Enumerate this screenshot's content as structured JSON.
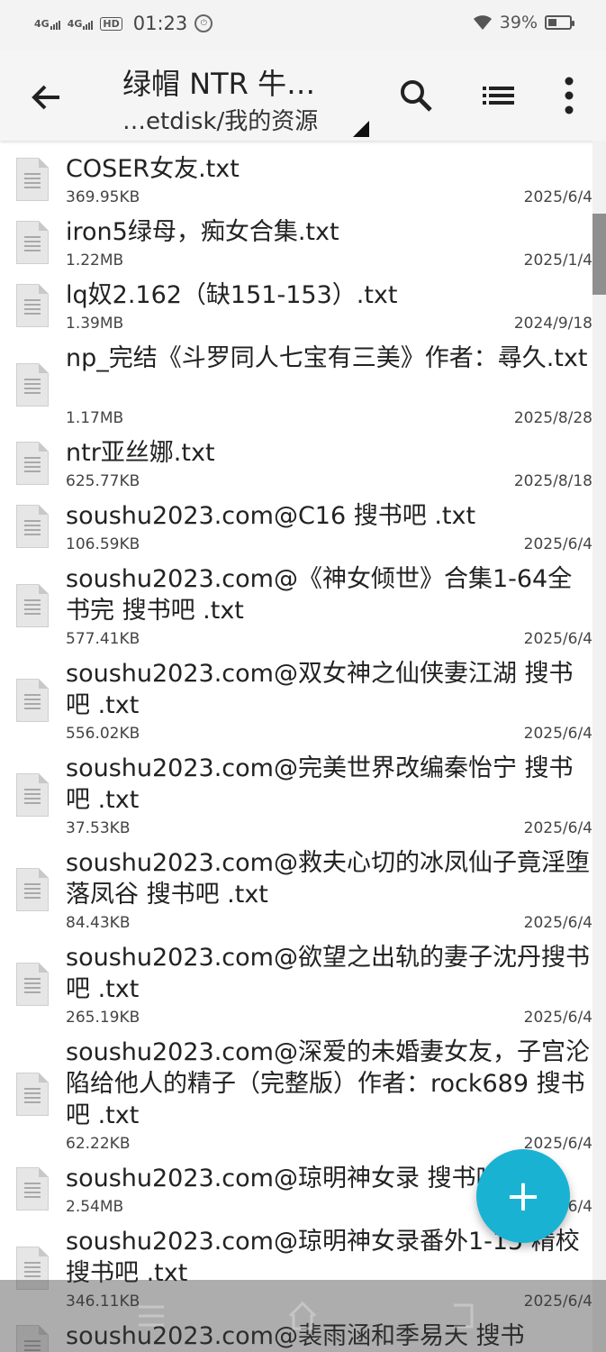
{
  "status_bar": {
    "network1": "4G",
    "network2": "4G",
    "hd": "HD",
    "time": "01:23",
    "battery": "39%",
    "battery_level": 0.39
  },
  "toolbar": {
    "title": "绿帽 NTR  牛…",
    "path": "…etdisk/我的资源",
    "icons": [
      "back-arrow-icon",
      "search-icon",
      "list-view-icon",
      "more-vertical-icon"
    ]
  },
  "files": [
    {
      "name": "COSER女友.txt",
      "size": "369.95KB",
      "date": "2025/6/4"
    },
    {
      "name": "iron5绿母，痴女合集.txt",
      "size": "1.22MB",
      "date": "2025/1/4"
    },
    {
      "name": "lq奴2.162（缺151-153）.txt",
      "size": "1.39MB",
      "date": "2024/9/18"
    },
    {
      "name": "np_完结《斗罗同人七宝有三美》作者：尋久.txt",
      "size": "1.17MB",
      "date": "2025/8/28"
    },
    {
      "name": "ntr亚丝娜.txt",
      "size": "625.77KB",
      "date": "2025/8/18"
    },
    {
      "name": "soushu2023.com@C16  搜书吧 .txt",
      "size": "106.59KB",
      "date": "2025/6/4"
    },
    {
      "name": "soushu2023.com@《神女倾世》合集1-64全书完    搜书吧 .txt",
      "size": "577.41KB",
      "date": "2025/6/4"
    },
    {
      "name": "soushu2023.com@双女神之仙侠妻江湖 搜书吧 .txt",
      "size": "556.02KB",
      "date": "2025/6/4"
    },
    {
      "name": "soushu2023.com@完美世界改编秦怡宁 搜书吧 .txt",
      "size": "37.53KB",
      "date": "2025/6/4"
    },
    {
      "name": "soushu2023.com@救夫心切的冰凤仙子竟淫堕落凤谷 搜书吧 .txt",
      "size": "84.43KB",
      "date": "2025/6/4"
    },
    {
      "name": "soushu2023.com@欲望之出轨的妻子沈丹搜书吧 .txt",
      "size": "265.19KB",
      "date": "2025/6/4"
    },
    {
      "name": "soushu2023.com@深爱的未婚妻女友，子宫沦陷给他人的精子（完整版）作者：rock689 搜书吧 .txt",
      "size": "62.22KB",
      "date": "2025/6/4"
    },
    {
      "name": "soushu2023.com@琼明神女录 搜书吧 .txt",
      "size": "2.54MB",
      "date": "2025/6/4"
    },
    {
      "name": "soushu2023.com@琼明神女录番外1-15 精校 搜书吧 .txt",
      "size": "346.11KB",
      "date": "2025/6/4"
    },
    {
      "name": "soushu2023.com@裴雨涵和季易天 搜书",
      "size": "",
      "date": ""
    }
  ],
  "fab": {
    "label": "+",
    "icon": "add-icon"
  }
}
